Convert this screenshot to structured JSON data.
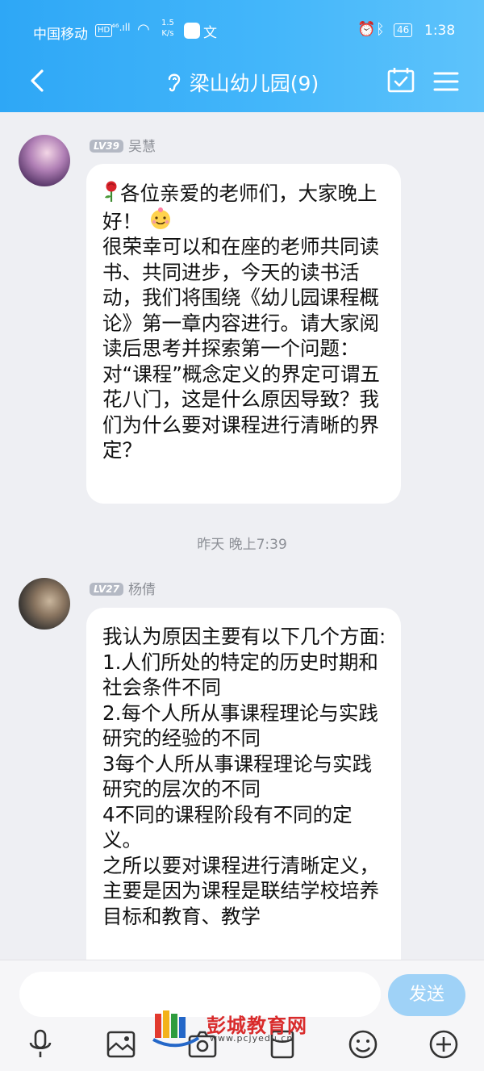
{
  "status_bar": {
    "carrier": "中国移动",
    "hd": "HD",
    "signal": "⁴⁶.ıll",
    "speed_value": "1.5",
    "speed_unit": "K/s",
    "battery": "46",
    "time": "1:38"
  },
  "header": {
    "title": "梁山幼儿园(9)"
  },
  "messages": [
    {
      "level": "LV39",
      "sender": "吴慧",
      "text_line1": "各位亲爱的老师们，大家晚上好！",
      "text_rest": "很荣幸可以和在座的老师共同读书、共同进步，今天的读书活动，我们将围绕《幼儿园课程概论》第一章内容进行。请大家阅读后思考并探索第一个问题：\n对“课程”概念定义的界定可谓五花八门，这是什么原因导致？我们为什么要对课程进行清晰的界定？"
    },
    {
      "level": "LV27",
      "sender": "杨倩",
      "text": "我认为原因主要有以下几个方面:\n1.人们所处的特定的历史时期和社会条件不同\n2.每个人所从事课程理论与实践研究的经验的不同\n3每个人所从事课程理论与实践研究的层次的不同\n4不同的课程阶段有不同的定义。\n之所以要对课程进行清晰定义，主要是因为课程是联结学校培养目标和教育、教学"
    }
  ],
  "timestamp": "昨天 晚上7:39",
  "input": {
    "placeholder": "",
    "send_label": "发送"
  },
  "watermark": {
    "name": "彭城教育网",
    "url": "www.pcjyedu.cn"
  },
  "colors": {
    "header_gradient_start": "#2ea7f6",
    "header_gradient_end": "#5ec3fb",
    "send_button": "#9fd2f7",
    "background": "#eeeff3"
  }
}
